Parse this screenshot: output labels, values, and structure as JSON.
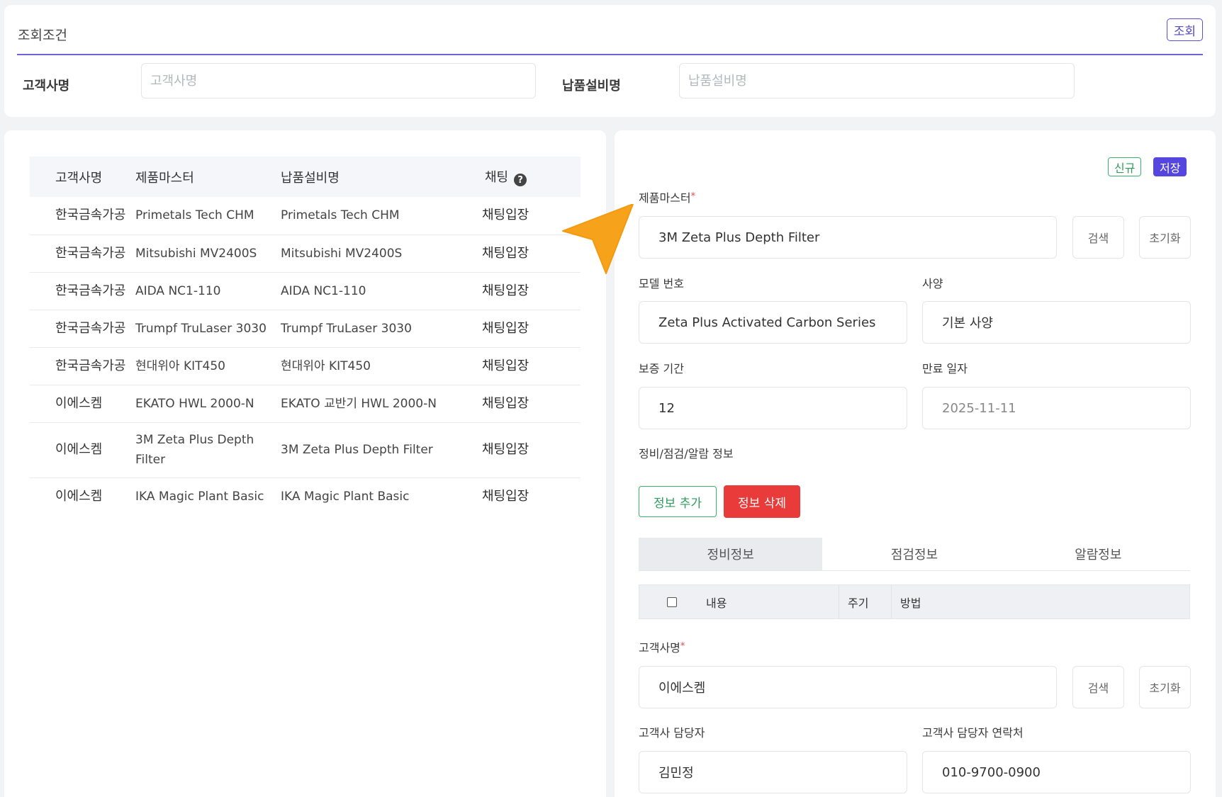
{
  "search": {
    "title": "조회조건",
    "submit_label": "조회",
    "customer_label": "고객사명",
    "customer_placeholder": "고객사명",
    "equipment_label": "납품설비명",
    "equipment_placeholder": "납품설비명"
  },
  "list": {
    "columns": {
      "customer": "고객사명",
      "product": "제품마스터",
      "equipment": "납품설비명",
      "chat": "채팅"
    },
    "rows": [
      {
        "customer": "한국금속가공",
        "product": "Primetals Tech CHM",
        "equipment": "Primetals Tech CHM",
        "chat": "채팅입장"
      },
      {
        "customer": "한국금속가공",
        "product": "Mitsubishi MV2400S",
        "equipment": "Mitsubishi MV2400S",
        "chat": "채팅입장"
      },
      {
        "customer": "한국금속가공",
        "product": "AIDA NC1-110",
        "equipment": "AIDA NC1-110",
        "chat": "채팅입장"
      },
      {
        "customer": "한국금속가공",
        "product": "Trumpf TruLaser 3030",
        "equipment": "Trumpf TruLaser 3030",
        "chat": "채팅입장"
      },
      {
        "customer": "한국금속가공",
        "product": "현대위아 KIT450",
        "equipment": "현대위아 KIT450",
        "chat": "채팅입장"
      },
      {
        "customer": "이에스켐",
        "product": "EKATO HWL 2000-N",
        "equipment": "EKATO 교반기 HWL 2000-N",
        "chat": "채팅입장"
      },
      {
        "customer": "이에스켐",
        "product": "3M Zeta Plus Depth Filter",
        "equipment": "3M Zeta Plus Depth Filter",
        "chat": "채팅입장"
      },
      {
        "customer": "이에스켐",
        "product": "IKA Magic Plant Basic",
        "equipment": "IKA Magic Plant Basic",
        "chat": "채팅입장"
      }
    ]
  },
  "detail": {
    "new_label": "신규",
    "save_label": "저장",
    "product_master_label": "제품마스터",
    "product_master_value": "3M Zeta Plus Depth Filter",
    "search_label": "검색",
    "reset_label": "초기화",
    "model_no_label": "모델 번호",
    "model_no_value": "Zeta Plus Activated Carbon Series",
    "spec_label": "사양",
    "spec_value": "기본 사양",
    "warranty_label": "보증 기간",
    "warranty_value": "12",
    "expiry_label": "만료 일자",
    "expiry_value": "2025-11-11",
    "info_section_label": "정비/점검/알람 정보",
    "info_add_label": "정보 추가",
    "info_delete_label": "정보 삭제",
    "tabs": [
      "정비정보",
      "점검정보",
      "알람정보"
    ],
    "sub_columns": {
      "content": "내용",
      "cycle": "주기",
      "method": "방법"
    },
    "customer_label": "고객사명",
    "customer_value": "이에스켐",
    "contact_label": "고객사 담당자",
    "contact_value": "김민정",
    "contact_phone_label": "고객사 담당자 연락처",
    "contact_phone_value": "010-9700-0900"
  },
  "colors": {
    "accent": "#5546e0",
    "success": "#3bb26a",
    "danger": "#ea3b3b",
    "cursor": "#f7a21b"
  },
  "icons": [
    "help-circle-icon",
    "cursor-arrow-icon"
  ]
}
